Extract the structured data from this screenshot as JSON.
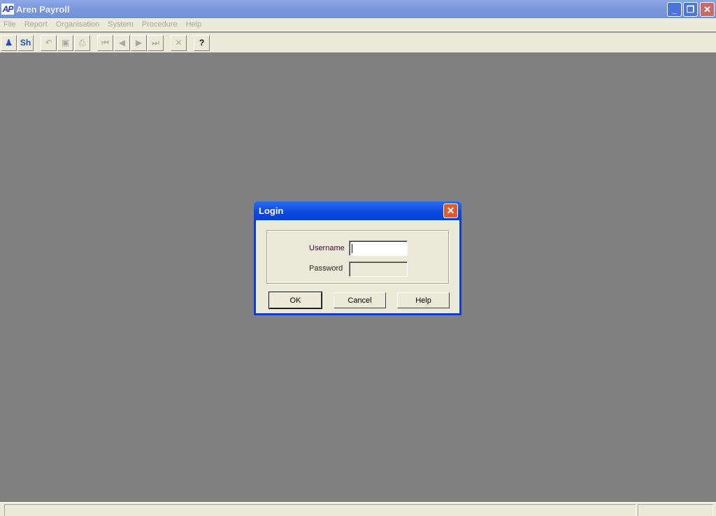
{
  "window": {
    "icon_text": "AP",
    "title": "Aren Payroll",
    "controls": {
      "minimize": "_",
      "restore": "❐",
      "close": "✕"
    }
  },
  "menu": [
    "File",
    "Report",
    "Organisation",
    "System",
    "Procedure",
    "Help"
  ],
  "toolbar": [
    {
      "name": "person-icon",
      "glyph": "♟",
      "state": "active"
    },
    {
      "name": "sh-button",
      "glyph": "Sh",
      "state": "active"
    },
    {
      "name": "undo-icon",
      "glyph": "↶",
      "state": "disabled"
    },
    {
      "name": "save-icon",
      "glyph": "▣",
      "state": "disabled"
    },
    {
      "name": "print-icon",
      "glyph": "⎙",
      "state": "disabled"
    },
    {
      "name": "first-record-icon",
      "glyph": "⏮",
      "state": "disabled"
    },
    {
      "name": "previous-record-icon",
      "glyph": "◀",
      "state": "disabled"
    },
    {
      "name": "next-record-icon",
      "glyph": "▶",
      "state": "disabled"
    },
    {
      "name": "last-record-icon",
      "glyph": "⏭",
      "state": "disabled"
    },
    {
      "name": "delete-icon",
      "glyph": "✕",
      "state": "disabled"
    },
    {
      "name": "help-icon",
      "glyph": "?",
      "state": "dark"
    }
  ],
  "dialog": {
    "title": "Login",
    "close_glyph": "✕",
    "username_label": "Username",
    "username_value": "",
    "password_label": "Password",
    "password_value": "",
    "ok_label": "OK",
    "cancel_label": "Cancel",
    "help_label": "Help"
  },
  "status": {
    "pane1": "",
    "pane2": ""
  }
}
